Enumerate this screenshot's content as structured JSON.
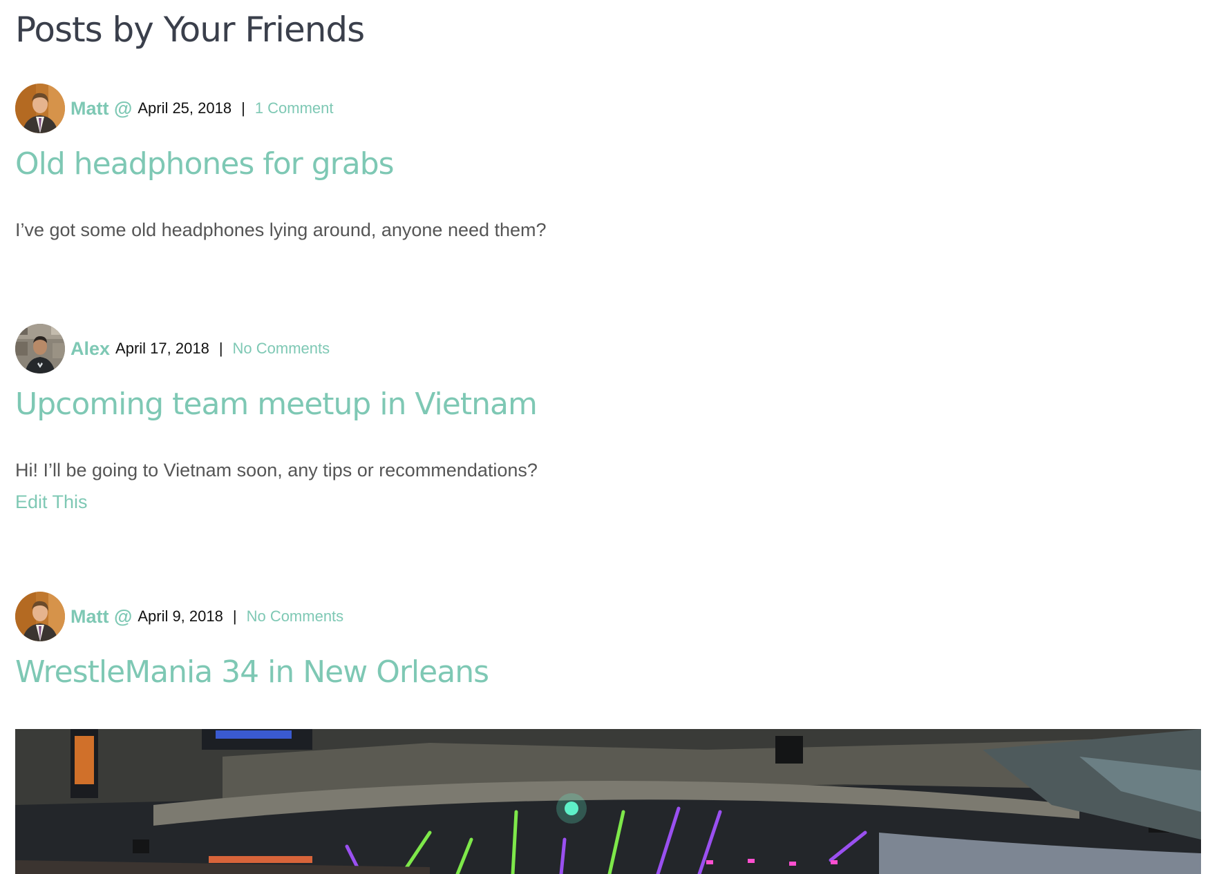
{
  "page": {
    "title": "Posts by Your Friends"
  },
  "posts": [
    {
      "author": "Matt @",
      "date": "April 25, 2018",
      "separator": "|",
      "comments": "1 Comment",
      "title": "Old headphones for grabs",
      "body": "I’ve got some old headphones lying around, anyone need them?",
      "avatar_icon": "user-avatar-matt"
    },
    {
      "author": "Alex",
      "date": "April 17, 2018",
      "separator": "|",
      "comments": "No Comments",
      "title": "Upcoming team meetup in Vietnam",
      "body": "Hi! I’ll be going to Vietnam soon, any tips or recommendations?",
      "edit_label": "Edit This",
      "avatar_icon": "user-avatar-alex"
    },
    {
      "author": "Matt @",
      "date": "April 9, 2018",
      "separator": "|",
      "comments": "No Comments",
      "title": "WrestleMania 34 in New Orleans",
      "image_icon": "arena-photo"
    }
  ],
  "colors": {
    "accent": "#7ec8b4",
    "heading": "#3a3f4b",
    "body_text": "#555555",
    "meta_text": "#111111"
  }
}
